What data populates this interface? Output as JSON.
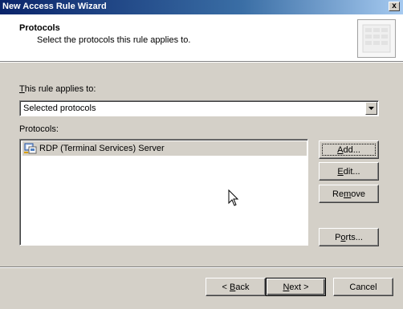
{
  "window": {
    "title": "New Access Rule Wizard",
    "close_glyph": "x"
  },
  "header": {
    "title": "Protocols",
    "subtitle": "Select the protocols this rule applies to."
  },
  "applies": {
    "label_accel": "T",
    "label_rest": "his rule applies to:",
    "selected_value": "Selected protocols"
  },
  "protocols": {
    "label": "Protocols:",
    "items": [
      {
        "label": "RDP (Terminal Services) Server",
        "icon": "protocol-icon"
      }
    ]
  },
  "side_buttons": {
    "add": {
      "accel": "A",
      "rest": "dd..."
    },
    "edit": {
      "accel": "E",
      "rest": "dit..."
    },
    "remove_pre": "Re",
    "remove_accel": "m",
    "remove_post": "ove",
    "ports_pre": "P",
    "ports_accel": "o",
    "ports_post": "rts..."
  },
  "nav_buttons": {
    "back_pre": "< ",
    "back_accel": "B",
    "back_post": "ack",
    "next_accel": "N",
    "next_post": "ext >",
    "cancel": "Cancel"
  },
  "colors": {
    "face": "#d4d0c8",
    "titlebar_start": "#0a246a",
    "titlebar_end": "#a6caf0",
    "highlight_row": "#d4d0c8"
  }
}
